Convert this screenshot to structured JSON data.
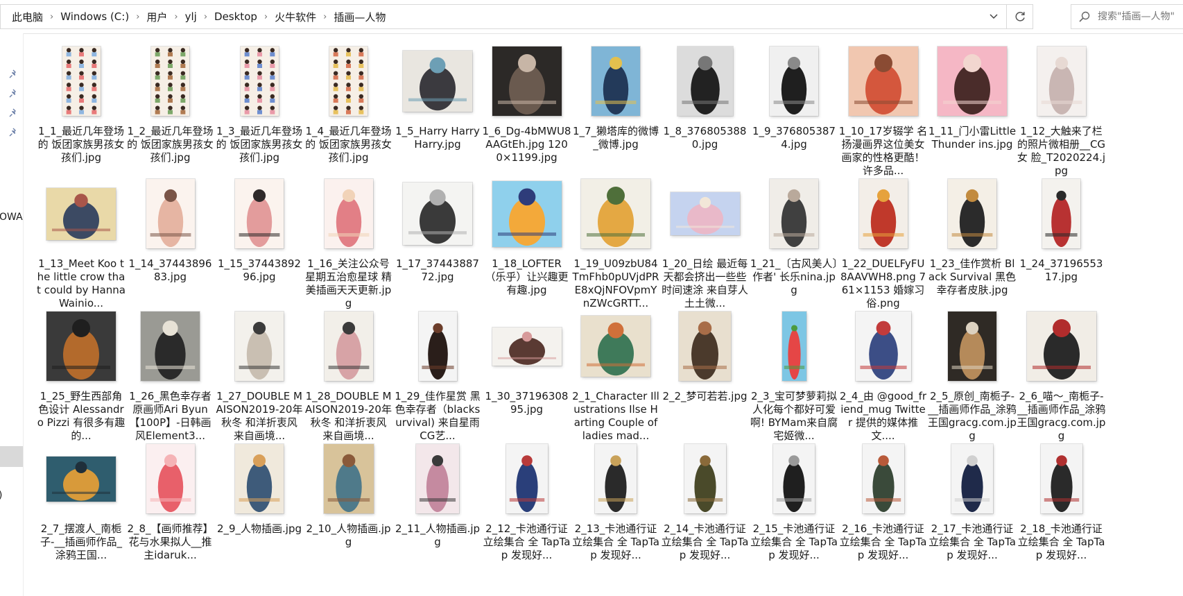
{
  "address_bar": {
    "crumbs": [
      "此电脑",
      "Windows (C:)",
      "用户",
      "ylj",
      "Desktop",
      "火牛软件",
      "插画—人物"
    ]
  },
  "search": {
    "placeholder": "搜索\"插画—人物\""
  },
  "nav_pane": {
    "fragments": [
      "OWA",
      ")"
    ]
  },
  "files": [
    {
      "name": "1_1_最近几年登场的 饭团家族男孩女孩们.jpg",
      "thumb": "sprite-sheet-thumbnail",
      "colors": [
        "#f6efe6",
        "#e87a7a",
        "#8fb6e0"
      ]
    },
    {
      "name": "1_2_最近几年登场的 饭团家族男孩女孩们.jpg",
      "thumb": "sprite-sheet-thumbnail",
      "colors": [
        "#f6efe6",
        "#b07b52",
        "#7da86a"
      ]
    },
    {
      "name": "1_3_最近几年登场的 饭团家族男孩女孩们.jpg",
      "thumb": "sprite-sheet-thumbnail",
      "colors": [
        "#f6efe6",
        "#e99aa9",
        "#6f8fd0"
      ]
    },
    {
      "name": "1_4_最近几年登场的 饭团家族男孩女孩们.jpg",
      "thumb": "sprite-sheet-thumbnail",
      "colors": [
        "#f6efe6",
        "#e7c15e",
        "#d97a5a"
      ]
    },
    {
      "name": "1_5_Harry Harry Harry.jpg",
      "thumb": "illustration-thumbnail",
      "colors": [
        "#e9e6e0",
        "#3b3a3f",
        "#6d9fb5"
      ]
    },
    {
      "name": "1_6_Dg-4bMWU8AAGtEh.jpg 1200×1199.jpg",
      "thumb": "illustration-thumbnail",
      "colors": [
        "#2c2927",
        "#6a5a4f",
        "#c7b5a6"
      ]
    },
    {
      "name": "1_7_獭塔库的微博_微博.jpg",
      "thumb": "illustration-thumbnail",
      "colors": [
        "#7fb5d6",
        "#233a5a",
        "#e3c04e"
      ]
    },
    {
      "name": "1_8_3768053880.jpg",
      "thumb": "illustration-thumbnail",
      "colors": [
        "#dcdcdc",
        "#222222",
        "#777777"
      ]
    },
    {
      "name": "1_9_3768053874.jpg",
      "thumb": "illustration-thumbnail",
      "colors": [
        "#f0f0f0",
        "#1f1f1f",
        "#8a8a8a"
      ]
    },
    {
      "name": "1_10_17岁辍学 名扬漫画界这位美女画家的性格更酷！ 许多品...",
      "thumb": "illustration-thumbnail",
      "colors": [
        "#f1c7b0",
        "#d4573d",
        "#8a4b33"
      ]
    },
    {
      "name": "1_11_门小雷Little Thunder ins.jpg",
      "thumb": "illustration-thumbnail",
      "colors": [
        "#f5b7c5",
        "#4a2c2a",
        "#f2d6cf"
      ]
    },
    {
      "name": "1_12_大触来了栏的照片微相册__CG 女 脸_T2020224.jpg",
      "thumb": "illustration-thumbnail",
      "colors": [
        "#f4f0ee",
        "#c9b6b3",
        "#e7d9d3"
      ]
    },
    {
      "name": "1_13_Meet Koo the little crow that could by Hanna Wainio...",
      "thumb": "illustration-thumbnail",
      "colors": [
        "#e9d9a8",
        "#3c4a63",
        "#a8564a"
      ]
    },
    {
      "name": "1_14_3744389683.jpg",
      "thumb": "illustration-thumbnail",
      "colors": [
        "#fbf3ee",
        "#e6b5a3",
        "#7a5548"
      ]
    },
    {
      "name": "1_15_3744389296.jpg",
      "thumb": "illustration-thumbnail",
      "colors": [
        "#fbf3ee",
        "#e39c9c",
        "#2f2a2a"
      ]
    },
    {
      "name": "1_16_关注公众号 星期五治愈星球 精美插画天天更新.jpg",
      "thumb": "illustration-thumbnail",
      "colors": [
        "#fbf1ee",
        "#e27f86",
        "#f1d3b8"
      ]
    },
    {
      "name": "1_17_3744388772.jpg",
      "thumb": "illustration-thumbnail",
      "colors": [
        "#f4f4f2",
        "#3a3a3a",
        "#b0b0b0"
      ]
    },
    {
      "name": "1_18_LOFTER（乐乎）让兴趣更有趣.jpg",
      "thumb": "illustration-thumbnail",
      "colors": [
        "#8fd0ec",
        "#f3a93a",
        "#2e3c7a"
      ]
    },
    {
      "name": "1_19_U09zbU84TmFhb0pUVjdPRE8xQjNFOVpmYnZWcGRTT...",
      "thumb": "illustration-thumbnail",
      "colors": [
        "#f2efe6",
        "#e4a843",
        "#4f6f3a"
      ]
    },
    {
      "name": "1_20_日绘 最近每天都会挤出一些些时间速涂 来自芽人土土微...",
      "thumb": "illustration-thumbnail",
      "colors": [
        "#c5d3ef",
        "#e9b9c9",
        "#f2e7d8"
      ]
    },
    {
      "name": "1_21_〔古风美人〕作者' 长乐nina.jpg",
      "thumb": "illustration-thumbnail",
      "colors": [
        "#f0ede8",
        "#404040",
        "#b9a99b"
      ]
    },
    {
      "name": "1_22_DUELFyFU8AAVWH8.png 761×1153 婚嫁习俗.png",
      "thumb": "illustration-thumbnail",
      "colors": [
        "#f3eee8",
        "#c0392b",
        "#e6a23c"
      ]
    },
    {
      "name": "1_23_佳作赏析 Black Survival 黑色幸存者皮肤.jpg",
      "thumb": "illustration-thumbnail",
      "colors": [
        "#f4efe6",
        "#2b2b2b",
        "#c28b3f"
      ]
    },
    {
      "name": "1_24_3719655317.jpg",
      "thumb": "illustration-thumbnail",
      "colors": [
        "#f4f2ee",
        "#b83232",
        "#2a2a2a"
      ]
    },
    {
      "name": "1_25_野生西部角色设计 Alessandro Pizzi 有很多有趣的...",
      "thumb": "illustration-thumbnail",
      "colors": [
        "#3a3a3a",
        "#b36a2c",
        "#1f1f1f"
      ]
    },
    {
      "name": "1_26_黑色幸存者 原画师Ari Byun 【100P】-日韩画风Element3...",
      "thumb": "illustration-thumbnail",
      "colors": [
        "#9a9a94",
        "#2a2a2a",
        "#e7e2d6"
      ]
    },
    {
      "name": "1_27_DOUBLE MAISON2019-20年秋冬 和洋折衷风 来自画境...",
      "thumb": "illustration-thumbnail",
      "colors": [
        "#f3f1ec",
        "#c9bfb2",
        "#3b3b3b"
      ]
    },
    {
      "name": "1_28_DOUBLE MAISON2019-20年秋冬 和洋折衷风 来自画境...",
      "thumb": "illustration-thumbnail",
      "colors": [
        "#f2efe9",
        "#d7a3a6",
        "#3b3b3b"
      ]
    },
    {
      "name": "1_29_佳作星赏 黑色幸存者（blacksurvival) 来自星雨CG艺...",
      "thumb": "illustration-thumbnail",
      "colors": [
        "#f4f4f4",
        "#2a1e1a",
        "#6b3d2a"
      ]
    },
    {
      "name": "1_30_3719630895.jpg",
      "thumb": "illustration-thumbnail",
      "colors": [
        "#f4f2ee",
        "#5a3a33",
        "#d79a9a"
      ]
    },
    {
      "name": "2_1_Character Illustrations Ilse Harting Couple of ladies mad...",
      "thumb": "illustration-thumbnail",
      "colors": [
        "#e9e0cd",
        "#3f7a5a",
        "#d0703a"
      ]
    },
    {
      "name": "2_2_梦可若若.jpg",
      "thumb": "illustration-thumbnail",
      "colors": [
        "#e8dfcf",
        "#4b3a2c",
        "#a86d48"
      ]
    },
    {
      "name": "2_3_宝可梦萝莉拟人化每个都好可爱啊! BYMam来自腐宅姬微...",
      "thumb": "illustration-thumbnail",
      "colors": [
        "#7dc6e4",
        "#e54646",
        "#4c9a3e"
      ]
    },
    {
      "name": "2_4_由 @good_friend_mug Twitter 提供的媒体推文....",
      "thumb": "illustration-thumbnail",
      "colors": [
        "#f4f4f4",
        "#3c4e86",
        "#c23b3b"
      ]
    },
    {
      "name": "2_5_原创_南栀子-__插画师作品_涂鸦王国gracg.com.jpg",
      "thumb": "illustration-thumbnail",
      "colors": [
        "#2f2a25",
        "#b58a5a",
        "#dcd1c0"
      ]
    },
    {
      "name": "2_6_喵～_南栀子-__插画师作品_涂鸦王国gracg.com.jpg",
      "thumb": "illustration-thumbnail",
      "colors": [
        "#f1ede6",
        "#2a2a2a",
        "#b12c2c"
      ]
    },
    {
      "name": "2_7_摆渡人_南栀子-__插画师作品_涂鸦王国...",
      "thumb": "illustration-thumbnail",
      "colors": [
        "#2f5d6e",
        "#d89a3a",
        "#1f2f3a"
      ]
    },
    {
      "name": "2_8_【画师推荐】花与水果拟人__推主idaruk...",
      "thumb": "illustration-thumbnail",
      "colors": [
        "#fbeff0",
        "#e8606a",
        "#f5b3b6"
      ]
    },
    {
      "name": "2_9_人物插画.jpg",
      "thumb": "illustration-thumbnail",
      "colors": [
        "#f0e9dc",
        "#3e5b7a",
        "#d9a05a"
      ]
    },
    {
      "name": "2_10_人物插画.jpg",
      "thumb": "illustration-thumbnail",
      "colors": [
        "#d8c39a",
        "#4f7a8a",
        "#8a5a3a"
      ]
    },
    {
      "name": "2_11_人物插画.jpg",
      "thumb": "illustration-thumbnail",
      "colors": [
        "#f3e7ea",
        "#c58aa0",
        "#3a3a3a"
      ]
    },
    {
      "name": "2_12_卡池通行证立绘集合 全 TapTap 发现好...",
      "thumb": "illustration-thumbnail",
      "colors": [
        "#f4f4f4",
        "#2a3f7a",
        "#b83a3a"
      ]
    },
    {
      "name": "2_13_卡池通行证立绘集合 全 TapTap 发现好...",
      "thumb": "illustration-thumbnail",
      "colors": [
        "#f4f4f4",
        "#2a2a2a",
        "#c9a25a"
      ]
    },
    {
      "name": "2_14_卡池通行证立绘集合 全 TapTap 发现好...",
      "thumb": "illustration-thumbnail",
      "colors": [
        "#f4f4f4",
        "#4a4a2a",
        "#8a6a3a"
      ]
    },
    {
      "name": "2_15_卡池通行证立绘集合 全 TapTap 发现好...",
      "thumb": "illustration-thumbnail",
      "colors": [
        "#f4f4f4",
        "#1f1f1f",
        "#9a9a9a"
      ]
    },
    {
      "name": "2_16_卡池通行证立绘集合 全 TapTap 发现好...",
      "thumb": "illustration-thumbnail",
      "colors": [
        "#f4f4f4",
        "#3a4a3a",
        "#b85a3a"
      ]
    },
    {
      "name": "2_17_卡池通行证立绘集合 全 TapTap 发现好...",
      "thumb": "illustration-thumbnail",
      "colors": [
        "#f4f4f4",
        "#1f2a4a",
        "#d0d0d0"
      ]
    },
    {
      "name": "2_18_卡池通行证立绘集合 全 TapTap 发现好...",
      "thumb": "illustration-thumbnail",
      "colors": [
        "#f4f4f4",
        "#2a2a2a",
        "#b03030"
      ]
    }
  ]
}
